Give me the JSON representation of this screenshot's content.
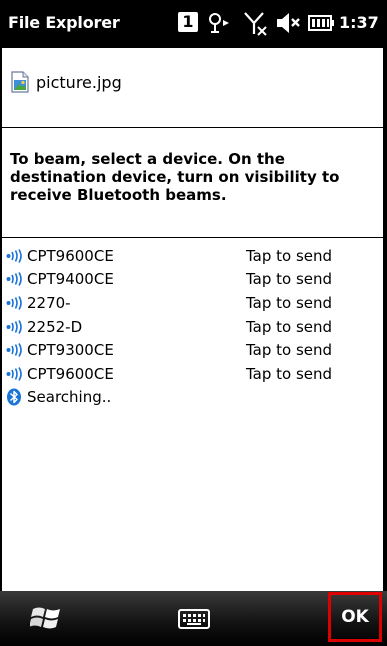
{
  "statusbar": {
    "title": "File Explorer",
    "notification_count": "1",
    "time": "1:37",
    "icons": [
      "notification-badge-icon",
      "connectivity-icon",
      "signal-off-icon",
      "volume-muted-icon",
      "battery-icon"
    ]
  },
  "file": {
    "icon": "jpg-file-icon",
    "name": "picture.jpg"
  },
  "instructions": "To beam, select a device. On the destination device, turn on visibility to receive Bluetooth beams.",
  "devices": [
    {
      "name": "CPT9600CE",
      "action": "Tap to send"
    },
    {
      "name": "CPT9400CE",
      "action": "Tap to send"
    },
    {
      "name": "2270-",
      "action": "Tap to send"
    },
    {
      "name": "2252-D",
      "action": "Tap to send"
    },
    {
      "name": "CPT9300CE",
      "action": "Tap to send"
    },
    {
      "name": "CPT9600CE",
      "action": "Tap to send"
    }
  ],
  "searching": "Searching..",
  "softkeys": {
    "left_icon": "windows-start-icon",
    "center_icon": "keyboard-icon",
    "ok_label": "OK"
  },
  "colors": {
    "highlight_border": "#dd0000",
    "bluetooth_blue": "#1a73d9"
  }
}
